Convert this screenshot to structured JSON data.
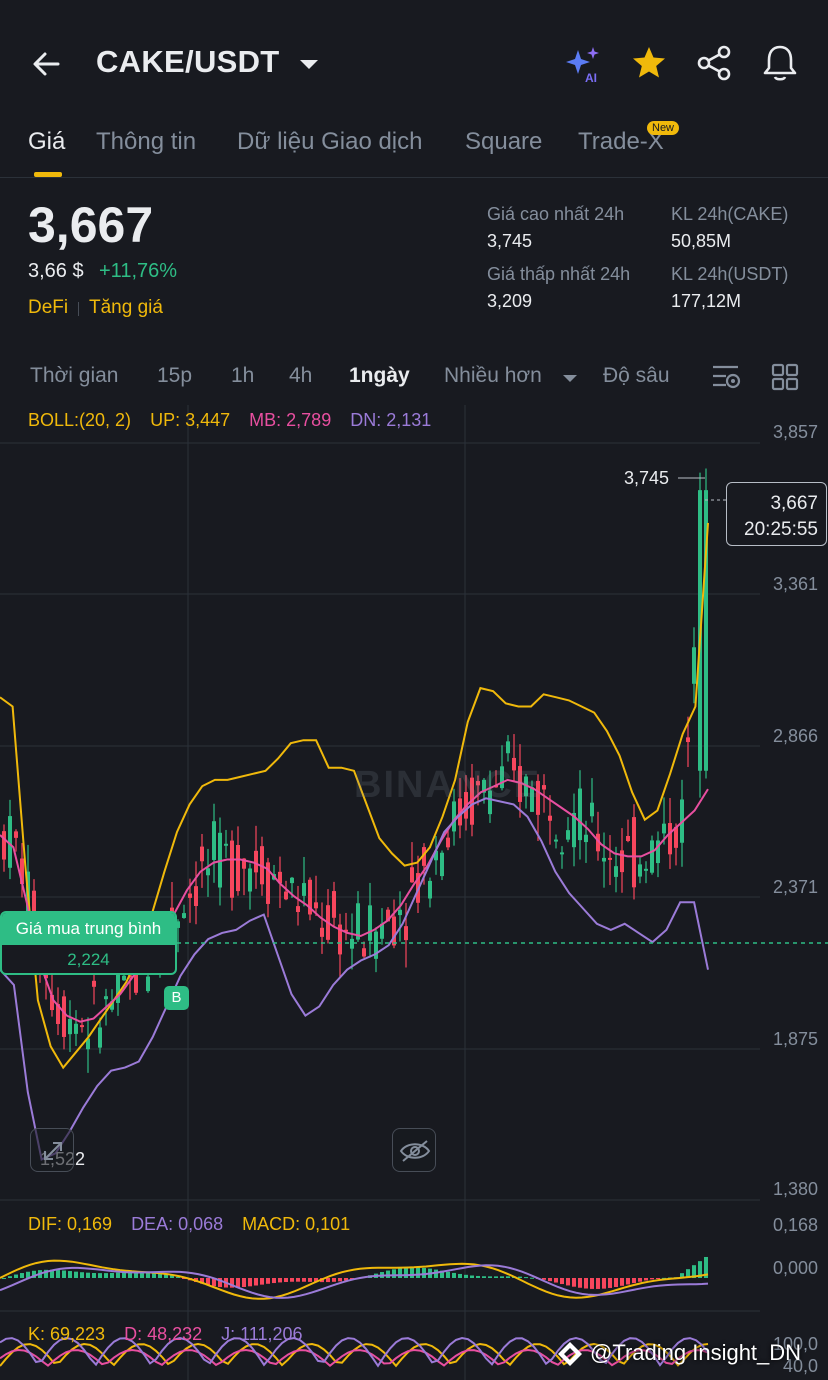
{
  "header": {
    "pair": "CAKE/USDT"
  },
  "tabs": [
    "Giá",
    "Thông tin",
    "Dữ liệu Giao dịch",
    "Square",
    "Trade-X"
  ],
  "new_badge": "New",
  "price": {
    "last": "3,667",
    "usd": "3,66 $",
    "change": "+11,76%",
    "tag1": "DeFi",
    "tag2": "Tăng giá"
  },
  "stats": {
    "high_label": "Giá cao nhất 24h",
    "high_value": "3,745",
    "low_label": "Giá thấp nhất 24h",
    "low_value": "3,209",
    "vol_base_label": "KL 24h(CAKE)",
    "vol_base_value": "50,85M",
    "vol_quote_label": "KL 24h(USDT)",
    "vol_quote_value": "177,12M"
  },
  "timeframes": [
    "Thời gian",
    "15p",
    "1h",
    "4h",
    "1ngày",
    "Nhiều hơn",
    "Độ sâu"
  ],
  "boll": {
    "label": "BOLL:(20, 2)",
    "up": "UP: 3,447",
    "mb": "MB: 2,789",
    "dn": "DN: 2,131"
  },
  "axis": {
    "price_ticks": [
      "3,857",
      "3,361",
      "2,866",
      "2,371",
      "1,875",
      "1,380"
    ],
    "macd_ticks": [
      "0,168",
      "0,000"
    ],
    "kdj_ticks": [
      "100,0",
      "40,0"
    ]
  },
  "markers": {
    "high": "3,745",
    "current_price": "3,667",
    "current_time": "20:25:55",
    "low": "1,522",
    "avg_buy_label": "Giá mua trung bình",
    "avg_buy_value": "2,224",
    "buy_marker": "B"
  },
  "watermark": "BINANCE",
  "macd": {
    "dif": "DIF: 0,169",
    "dea": "DEA: 0,068",
    "macd": "MACD: 0,101"
  },
  "kdj": {
    "k": "K: 69,223",
    "d": "D: 48,232",
    "j": "J: 111,206"
  },
  "credit": "@Trading Insight_DN",
  "colors": {
    "up": "#2ebd85",
    "down": "#f6465d",
    "accent": "#f0b90b",
    "mb": "#e84fa0",
    "dn": "#9b7bd8"
  },
  "chart_data": {
    "type": "candlestick",
    "price_range": [
      1380,
      3857
    ],
    "boll_up": [
      2990,
      2960,
      2440,
      2000,
      1850,
      1780,
      1830,
      1880,
      1940,
      2000,
      2060,
      2150,
      2280,
      2420,
      2550,
      2640,
      2700,
      2720,
      2720,
      2730,
      2740,
      2750,
      2790,
      2840,
      2850,
      2850,
      2760,
      2760,
      2750,
      2640,
      2530,
      2480,
      2440,
      2450,
      2500,
      2600,
      2720,
      2910,
      3020,
      3010,
      2970,
      2960,
      2960,
      3000,
      2990,
      2980,
      2960,
      2940,
      2880,
      2800,
      2680,
      2590,
      2620,
      2740,
      2870,
      2960,
      3560
    ],
    "boll_mb": [
      2540,
      2500,
      2320,
      2120,
      2000,
      1950,
      1930,
      1940,
      1980,
      2020,
      2080,
      2130,
      2200,
      2280,
      2360,
      2420,
      2450,
      2460,
      2460,
      2450,
      2430,
      2380,
      2340,
      2310,
      2270,
      2240,
      2220,
      2210,
      2230,
      2260,
      2310,
      2380,
      2440,
      2520,
      2590,
      2640,
      2680,
      2700,
      2720,
      2710,
      2690,
      2660,
      2630,
      2600,
      2560,
      2510,
      2480,
      2470,
      2470,
      2490,
      2540,
      2580,
      2620,
      2690
    ],
    "boll_dn": [
      2100,
      2050,
      1700,
      1480,
      1500,
      1570,
      1650,
      1720,
      1770,
      1780,
      1800,
      1880,
      1980,
      2080,
      2150,
      2200,
      2220,
      2230,
      2260,
      2280,
      2150,
      2020,
      1950,
      1980,
      2050,
      2100,
      2130,
      2150,
      2180,
      2250,
      2350,
      2450,
      2550,
      2600,
      2640,
      2660,
      2650,
      2640,
      2600,
      2520,
      2420,
      2350,
      2300,
      2250,
      2230,
      2250,
      2220,
      2190,
      2230,
      2320,
      2320,
      2100
    ]
  }
}
